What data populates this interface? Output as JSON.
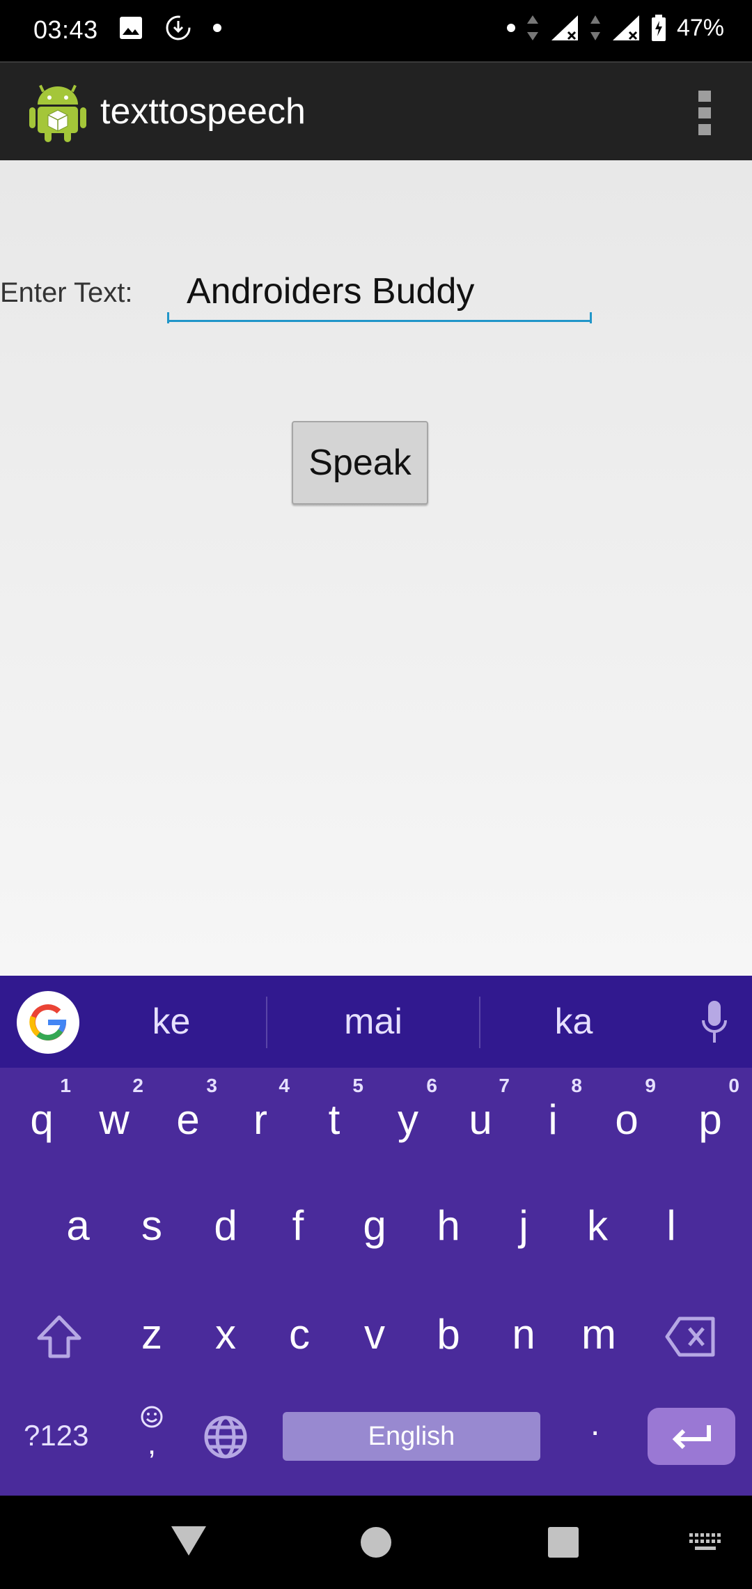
{
  "status_bar": {
    "time": "03:43",
    "battery": "47%",
    "icons": [
      "image-icon",
      "download-icon",
      "dot-icon",
      "dot-icon",
      "data-arrows-icon",
      "signal-icon",
      "signal-icon",
      "battery-icon"
    ]
  },
  "app_bar": {
    "title": "texttospeech",
    "icon": "android-icon",
    "overflow": "more-vert-icon"
  },
  "content": {
    "label": "Enter Text:",
    "input_value": "Androiders Buddy",
    "speak_button": "Speak"
  },
  "keyboard": {
    "suggestions": [
      "ke",
      "mai",
      "ka"
    ],
    "row1": [
      {
        "letter": "q",
        "hint": "1"
      },
      {
        "letter": "w",
        "hint": "2"
      },
      {
        "letter": "e",
        "hint": "3"
      },
      {
        "letter": "r",
        "hint": "4"
      },
      {
        "letter": "t",
        "hint": "5"
      },
      {
        "letter": "y",
        "hint": "6"
      },
      {
        "letter": "u",
        "hint": "7"
      },
      {
        "letter": "i",
        "hint": "8"
      },
      {
        "letter": "o",
        "hint": "9"
      },
      {
        "letter": "p",
        "hint": "0"
      }
    ],
    "row2": [
      "a",
      "s",
      "d",
      "f",
      "g",
      "h",
      "j",
      "k",
      "l"
    ],
    "row3": [
      "z",
      "x",
      "c",
      "v",
      "b",
      "n",
      "m"
    ],
    "symbols_key": "?123",
    "comma_key": ",",
    "space_label": "English",
    "period_key": ".",
    "colors": {
      "background": "#4a2b9b",
      "suggest_bar": "#31198f",
      "space": "#9889d0",
      "enter": "#9a78d4"
    }
  },
  "nav_bar": {
    "icons": [
      "back-icon",
      "home-icon",
      "recents-icon",
      "keyboard-switch-icon"
    ]
  }
}
